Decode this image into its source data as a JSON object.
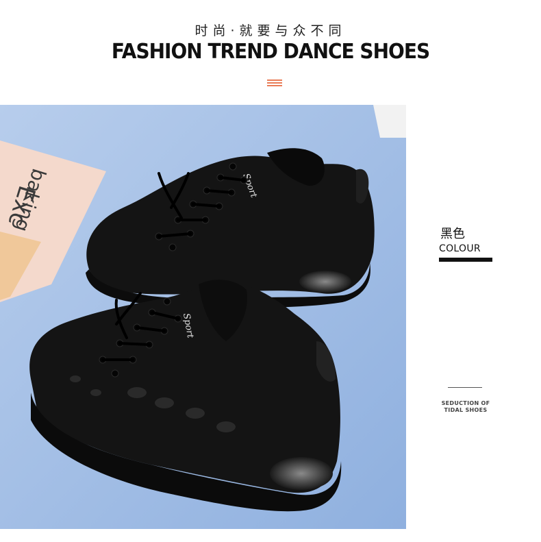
{
  "header": {
    "subtitle_zh": "时尚·就要与众不同",
    "title": "FASHION TREND DANCE SHOES"
  },
  "product_photo": {
    "paper_text_line1": "Exc",
    "paper_text_line2": "baking",
    "shoe_label": "Sport",
    "background_color": "#a9c3e6",
    "shoe_color": "#141414"
  },
  "colour": {
    "label_zh": "黑色",
    "label_en": "COLOUR"
  },
  "side_caption": {
    "line1": "SEDUCTION OF",
    "line2": "TIDAL SHOES"
  },
  "colors": {
    "accent": "#e97c57",
    "text": "#111111"
  }
}
